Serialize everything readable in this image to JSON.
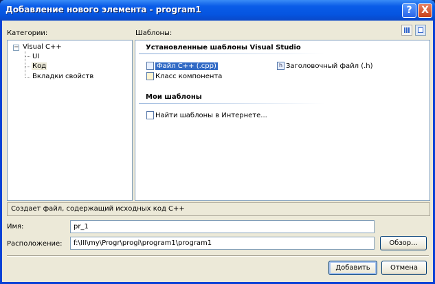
{
  "window": {
    "title": "Добавление нового элемента - program1",
    "help": "?",
    "close": "X"
  },
  "categories": {
    "label": "Категории:",
    "tree": [
      {
        "label": "Visual C++",
        "expander": "−"
      },
      {
        "label": "UI"
      },
      {
        "label": "Код"
      },
      {
        "label": "Вкладки свойств"
      }
    ]
  },
  "templates": {
    "label": "Шаблоны:",
    "installed_heading": "Установленные шаблоны Visual Studio",
    "installed": [
      {
        "label": "Файл C++ (.cpp)",
        "icon": "cpp-file-icon"
      },
      {
        "label": "Класс компонента",
        "icon": "component-class-icon"
      },
      {
        "label": "Заголовочный файл (.h)",
        "icon": "header-file-icon",
        "glyph": "h"
      }
    ],
    "my_heading": "Мои шаблоны",
    "my": [
      {
        "label": "Найти шаблоны в Интернете...",
        "icon": "search-online-icon"
      }
    ]
  },
  "description": "Создает файл, содержащий исходных код C++",
  "form": {
    "name_label": "Имя:",
    "name_value": "pr_1",
    "location_label": "Расположение:",
    "location_value": "f:\\III\\my\\Progr\\progi\\program1\\program1",
    "browse": "Обзор..."
  },
  "buttons": {
    "add": "Добавить",
    "cancel": "Отмена"
  }
}
